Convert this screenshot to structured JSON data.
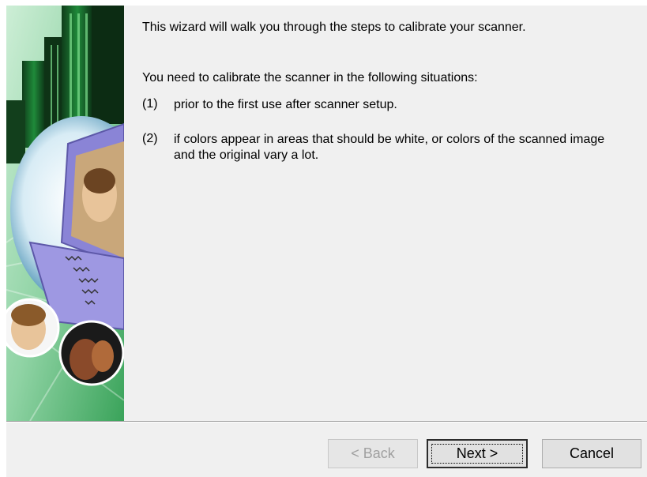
{
  "wizard": {
    "intro": "This wizard will walk you through the steps to calibrate your scanner.",
    "situations_heading": "You need to calibrate the scanner in the following situations:",
    "items": [
      {
        "number": "(1)",
        "text": "prior to the first use after scanner setup."
      },
      {
        "number": "(2)",
        "text": "if colors appear in areas that should be white, or colors of the scanned image and the original vary a lot."
      }
    ]
  },
  "buttons": {
    "back": "< Back",
    "next": "Next >",
    "cancel": "Cancel"
  },
  "colors": {
    "panel_bg": "#f0f0f0",
    "art_green": "#2e9a4a",
    "art_laptop": "#8a84d6",
    "disabled_text": "#a0a0a0"
  },
  "icons": {
    "side_art": "scanner-wizard-illustration"
  }
}
